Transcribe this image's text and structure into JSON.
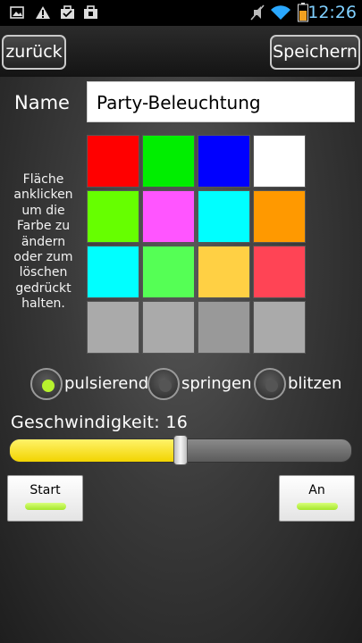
{
  "status_bar": {
    "time": "12:26",
    "icons": [
      "image-icon",
      "warning-icon",
      "briefcase-check-icon",
      "briefcase-icon",
      "mute-icon",
      "wifi-icon",
      "battery-icon"
    ]
  },
  "header": {
    "back_label": "zurück",
    "save_label": "Speichern"
  },
  "form": {
    "name_label": "Name",
    "name_value": "Party-Beleuchtung",
    "hint": "Fläche anklicken um die Farbe zu ändern oder zum löschen gedrückt halten."
  },
  "colors": [
    [
      "#ff0000",
      "#00ee00",
      "#0000ff",
      "#ffffff"
    ],
    [
      "#66ff00",
      "#ff55ff",
      "#00ffff",
      "#ff9900"
    ],
    [
      "#00ffff",
      "#55ff55",
      "#ffd044",
      "#ff4455"
    ],
    [
      "#aaaaaa",
      "#aaaaaa",
      "#999999",
      "#aaaaaa"
    ]
  ],
  "modes": {
    "options": [
      "pulsierend",
      "springen",
      "blitzen"
    ],
    "selected": "pulsierend"
  },
  "speed": {
    "label": "Geschwindigkeit: 16",
    "value": 16,
    "fraction": 0.5
  },
  "buttons": {
    "start_label": "Start",
    "on_label": "An"
  },
  "theme": {
    "accent_yellow": "#f2d400",
    "indicator_green": "#a4e62a",
    "radio_selected": "#b7f22e",
    "radio_unselected": "#555555"
  }
}
